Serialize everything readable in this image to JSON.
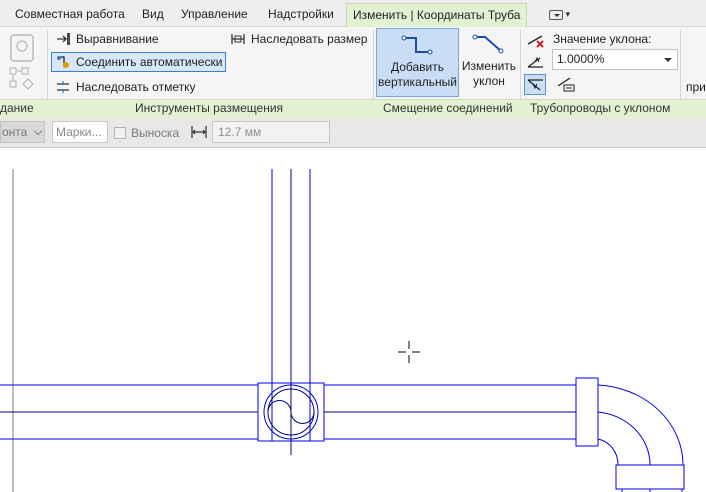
{
  "tabs": [
    {
      "label": "Совместная работа"
    },
    {
      "label": "Вид"
    },
    {
      "label": "Управление"
    },
    {
      "label": "Надстройки"
    },
    {
      "label": "Изменить | Координаты Труба"
    }
  ],
  "ribbon": {
    "cut_left_title": "дание",
    "placement": {
      "title": "Инструменты размещения",
      "align": "Выравнивание",
      "auto_connect": "Соединить автоматически",
      "inherit_elevation": "Наследовать отметку",
      "inherit_size": "Наследовать размер"
    },
    "offset": {
      "title": "Смещение соединений",
      "add_vertical_line1": "Добавить",
      "add_vertical_line2": "вертикальный",
      "change_slope_line1": "Изменить",
      "change_slope_line2": "уклон"
    },
    "sloped": {
      "title": "Трубопроводы с уклоном",
      "slope_label": "Значение уклона:",
      "slope_value": "1.0000%"
    },
    "cut_right": "при"
  },
  "options_bar": {
    "dropdown_cut": "онта",
    "mark_placeholder": "Марки...",
    "leader_label": "Выноска",
    "width_value": "12.7 мм"
  },
  "colors": {
    "pipe_line": "#0000ff",
    "active_tab_bg": "#e3f1d3",
    "selected_button": "#c9def5"
  }
}
